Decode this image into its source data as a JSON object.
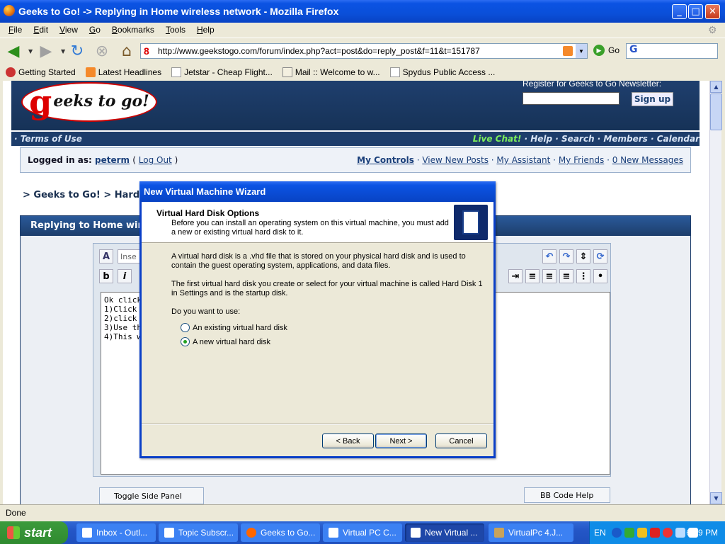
{
  "window": {
    "title": "Geeks to Go! -> Replying in Home wireless network - Mozilla Firefox",
    "buttons": {
      "minimize": "_",
      "maximize": "□",
      "close": "✕"
    }
  },
  "menu": [
    "File",
    "Edit",
    "View",
    "Go",
    "Bookmarks",
    "Tools",
    "Help"
  ],
  "nav": {
    "url": "http://www.geekstogo.com/forum/index.php?act=post&do=reply_post&f=11&t=151787",
    "go_label": "Go",
    "search_value": "G"
  },
  "bookmarks": [
    {
      "label": "Getting Started",
      "icon": "firefox-icon"
    },
    {
      "label": "Latest Headlines",
      "icon": "rss-icon"
    },
    {
      "label": "Jetstar - Cheap Flight...",
      "icon": "page-icon"
    },
    {
      "label": "Mail :: Welcome to w...",
      "icon": "mail-icon"
    },
    {
      "label": "Spydus Public Access ...",
      "icon": "page-icon"
    }
  ],
  "site": {
    "logo_g": "g",
    "logo_text": "eeks to go!",
    "newsletter_label": "Register for Geeks to Go Newsletter:",
    "signup": "Sign up",
    "terms": "· Terms of Use",
    "live_chat": "Live Chat!",
    "nav_links": " · Help · Search · Members · Calendar",
    "logged_in_prefix": "Logged in as: ",
    "username": "peterm",
    "logout": "Log Out",
    "user_links": {
      "my_controls": "My Controls",
      "view_new_posts": "View New Posts",
      "my_assistant": "My Assistant",
      "my_friends": "My Friends",
      "new_messages": "0 New Messages"
    },
    "breadcrumb": "> Geeks to Go! > Hardwa",
    "reply_header": "Replying to Home wirel",
    "insert_placeholder": "Inse",
    "textarea": "Ok click\n1)Click o\n2)click o\n3)Use th\n4)This wi",
    "toggle_side_panel": "Toggle Side Panel",
    "bbcode_help": "BB Code Help"
  },
  "wizard": {
    "title": "New Virtual Machine Wizard",
    "heading": "Virtual Hard Disk Options",
    "subheading": "Before you can install an operating system on this virtual machine, you must add a new or existing virtual hard disk to it.",
    "para1": "A virtual hard disk is a .vhd file that is stored on your physical hard disk and is used to contain the guest operating system, applications, and data files.",
    "para2": "The first virtual hard disk you create or select for your virtual machine is called Hard Disk 1 in Settings and is the startup disk.",
    "question": "Do you want to use:",
    "option_existing": "An existing virtual hard disk",
    "option_new": "A new virtual hard disk",
    "selected": "new",
    "back": "< Back",
    "next": "Next >",
    "cancel": "Cancel"
  },
  "status": "Done",
  "taskbar": {
    "start": "start",
    "tasks": [
      "Inbox - Outl...",
      "Topic Subscr...",
      "Geeks to Go...",
      "Virtual PC C...",
      "New Virtual ...",
      "VirtualPc 4.J..."
    ],
    "active_task": "New Virtual ...",
    "lang": "EN",
    "clock": "6:19 PM"
  }
}
